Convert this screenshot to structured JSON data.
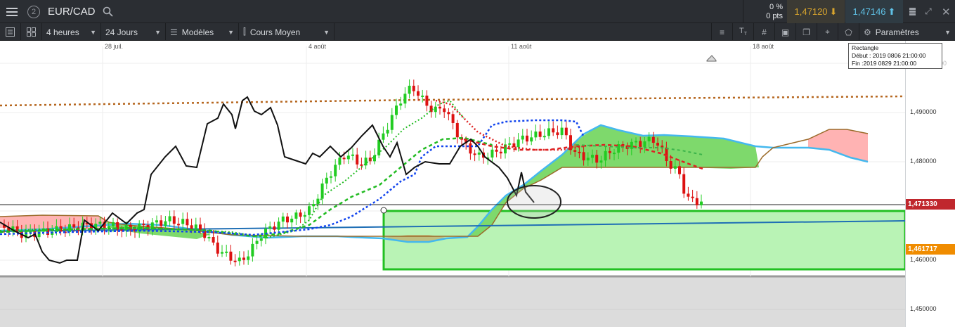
{
  "topbar": {
    "pair": "EUR/CAD",
    "circle_number": "2",
    "change_pct": "0 %",
    "change_pts": "0 pts",
    "sell_price": "1,47120",
    "buy_price": "1,47146",
    "icons": [
      "menu-icon",
      "search-icon",
      "arrow-down-icon",
      "arrow-up-icon",
      "collapse-icon",
      "close-icon"
    ]
  },
  "toolbar": {
    "interval": "4 heures",
    "range": "24 Jours",
    "models": "Modèles",
    "price_type": "Cours Moyen",
    "params": "Paramètres"
  },
  "chart": {
    "dates": [
      "28 juil.",
      "4 août",
      "11 août",
      "18 août"
    ],
    "price_ticks": [
      "1,490000",
      "1,480000",
      "1,460000",
      "1,450000"
    ],
    "current_price": "1,471330",
    "level_price": "1,461717",
    "tooltip": {
      "title": "Rectangle",
      "start": "Début : 2019 0806 21:00:00",
      "end": "Fin :2019 0829 21:00:00",
      "partial": "0000"
    },
    "colors": {
      "bull": "#22cc22",
      "bear": "#dd1111",
      "cloud_up": "#77dd66",
      "cloud_down": "#ffaaaa",
      "kijun": "#1144ee",
      "tenkan": "#dd2222",
      "trend": "#1f6fb5",
      "rect": "#9ff09a",
      "current_tag": "#c0272d",
      "level_tag": "#f08c00"
    }
  }
}
